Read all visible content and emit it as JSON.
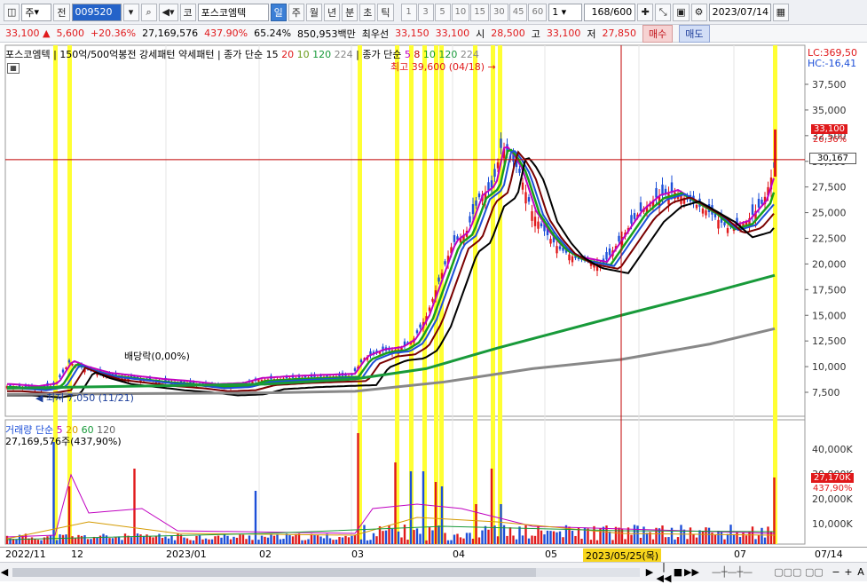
{
  "toolbar": {
    "type_select": "주",
    "prev_label": "전",
    "code": "009520",
    "market_label": "코",
    "stock_name": "포스코엠텍",
    "periods": [
      "일",
      "주",
      "월",
      "년",
      "분",
      "초",
      "틱"
    ],
    "active_period": "일",
    "intervals": [
      "1",
      "3",
      "5",
      "10",
      "15",
      "30",
      "45",
      "60"
    ],
    "interval_value": "1",
    "count": "168",
    "count_total": "/600",
    "date": "2023/07/14"
  },
  "quote": {
    "price": "33,100",
    "change": "5,600",
    "rate": "+20.36%",
    "volume": "27,169,576",
    "vol_rate": "437.90%",
    "ratio": "65.24%",
    "amount": "850,953백만",
    "ask_label": "최우선",
    "ask": "33,150",
    "bid": "33,100",
    "open_label": "시",
    "open": "28,500",
    "high_label": "고",
    "high": "33,100",
    "low_label": "저",
    "low": "27,850",
    "buy_label": "매수",
    "sell_label": "매도"
  },
  "legend": {
    "name": "포스코엠텍",
    "items": [
      "150억/500억봉전",
      "강세패턴",
      "약세패턴"
    ],
    "ma_label": "종가 단순 15",
    "ma_periods": [
      "20",
      "10",
      "120",
      "224"
    ],
    "ma2_label": "종가 단순",
    "ma2_periods": [
      "5",
      "8",
      "10",
      "120",
      "224"
    ],
    "lc": "LC:369,50",
    "hc": "HC:-16,41",
    "hi_marker": "최고 39,600 (04/18)",
    "lo_marker": "최저 7,050 (11/21)",
    "dividend": "배당락(0,00%)",
    "vol_title": "거래량",
    "vol_ma_label": "단순",
    "vol_ma_periods": [
      "5",
      "20",
      "60",
      "120"
    ],
    "vol_value": "27,169,576주(437,90%)"
  },
  "price_tags": {
    "last": "33,100",
    "last_rate": "20,36%",
    "cursor": "30,167",
    "vol_last": "27,170K",
    "vol_rate": "437,90%"
  },
  "chart_data": {
    "type": "candlestick",
    "y_ticks": [
      "37,500",
      "35,000",
      "32,500",
      "30,000",
      "27,500",
      "25,000",
      "22,500",
      "20,000",
      "17,500",
      "15,000",
      "12,500",
      "10,000",
      "7,500"
    ],
    "vol_ticks": [
      "40,000K",
      "30,000K",
      "20,000K",
      "10,000K"
    ],
    "x_ticks": [
      "2022/11",
      "12",
      "2023/01",
      "02",
      "03",
      "04",
      "05",
      "2023/05/25(목)",
      "07",
      "07/14"
    ]
  },
  "colors": {
    "up": "#e0191b",
    "down": "#1d4fd8",
    "highlight": "#ffff33"
  }
}
